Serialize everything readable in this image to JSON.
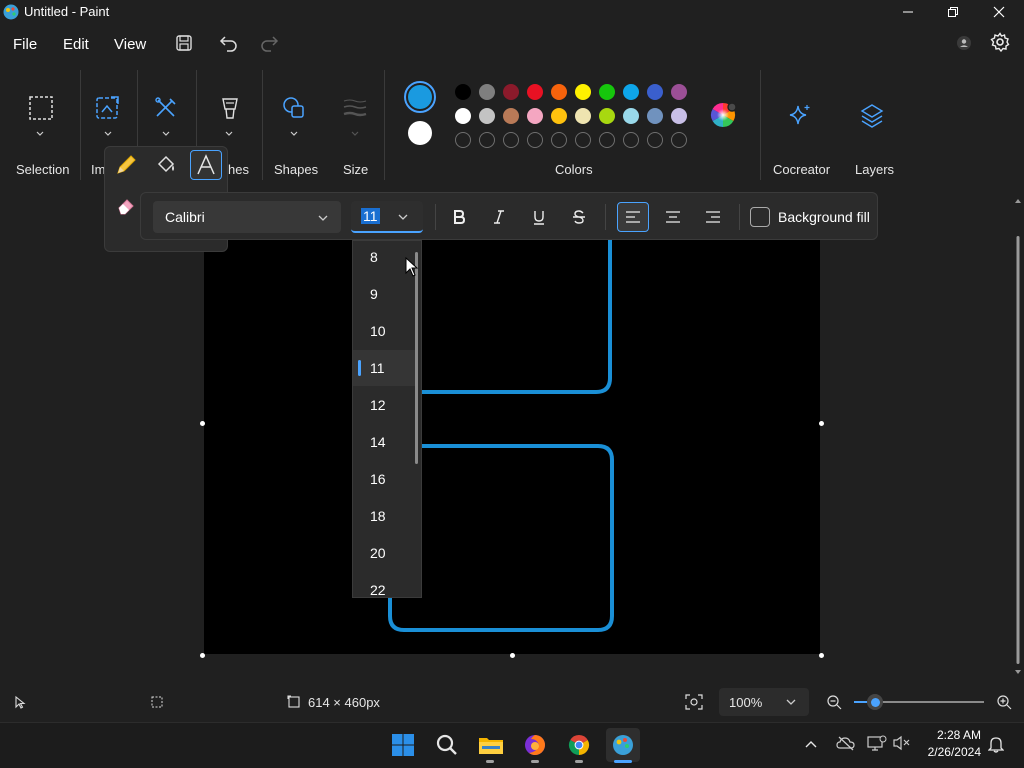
{
  "window": {
    "title": "Untitled - Paint"
  },
  "menu": {
    "file": "File",
    "edit": "Edit",
    "view": "View"
  },
  "ribbon": {
    "selection": "Selection",
    "image_partial": "Im",
    "brushes_partial": "hes",
    "shapes": "Shapes",
    "size": "Size",
    "colors": "Colors",
    "cocreator": "Cocreator",
    "layers": "Layers"
  },
  "colors": {
    "primary": "#1a9ae0",
    "secondary": "#ffffff",
    "palette_row1": [
      "#000000",
      "#7f7f7f",
      "#8b1a2b",
      "#e81123",
      "#f7630c",
      "#fff100",
      "#16c60c",
      "#0ea5e9",
      "#3a5fcd",
      "#9b4f96"
    ],
    "palette_row2": [
      "#ffffff",
      "#c3c3c3",
      "#b97a57",
      "#f4a6c1",
      "#ffc20e",
      "#efe4b0",
      "#a8d810",
      "#99d9ea",
      "#7092be",
      "#c8bfe7"
    ]
  },
  "text_toolbar": {
    "font": "Calibri",
    "size": "11",
    "background_fill": "Background fill"
  },
  "size_options": [
    "8",
    "9",
    "10",
    "11",
    "12",
    "14",
    "16",
    "18",
    "20",
    "22"
  ],
  "status": {
    "dimensions": "614 × 460px",
    "zoom": "100%",
    "zoom_level": 0.1
  },
  "taskbar": {
    "time": "2:28 AM",
    "date": "2/26/2024"
  }
}
